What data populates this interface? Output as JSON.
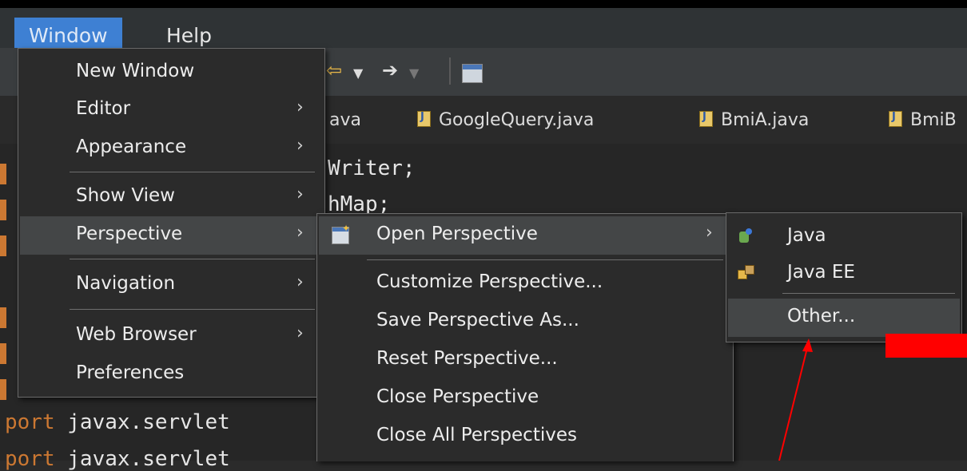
{
  "menubar": {
    "window": "Window",
    "help": "Help"
  },
  "tabs": [
    "ava",
    "GoogleQuery.java",
    "BmiA.java",
    "BmiB"
  ],
  "code": {
    "line1": "Writer;",
    "line2": "hMap;",
    "line3_kw": "port",
    "line3_rest": " javax.servlet",
    "line4_kw": "port",
    "line4_rest": " javax.servlet"
  },
  "window_menu": {
    "items": [
      {
        "label": "New Window"
      },
      {
        "label": "Editor",
        "submenu": true
      },
      {
        "label": "Appearance",
        "submenu": true
      },
      {
        "label": "Show View",
        "submenu": true
      },
      {
        "label": "Perspective",
        "submenu": true,
        "highlighted": true
      },
      {
        "label": "Navigation",
        "submenu": true
      },
      {
        "label": "Web Browser",
        "submenu": true
      },
      {
        "label": "Preferences"
      }
    ]
  },
  "perspective_menu": {
    "items": [
      {
        "label": "Open Perspective",
        "submenu": true,
        "highlighted": true,
        "icon": "open-perspective-icon"
      },
      {
        "label": "Customize Perspective..."
      },
      {
        "label": "Save Perspective As..."
      },
      {
        "label": "Reset Perspective..."
      },
      {
        "label": "Close Perspective"
      },
      {
        "label": "Close All Perspectives"
      }
    ]
  },
  "open_perspective_menu": {
    "items": [
      {
        "label": "Java",
        "icon": "java-perspective-icon"
      },
      {
        "label": "Java EE",
        "icon": "java-ee-perspective-icon"
      },
      {
        "label": "Other...",
        "highlighted": true
      }
    ]
  },
  "colors": {
    "accent": "#3e80d3",
    "highlight": "#444647",
    "annotation": "#ff0000"
  },
  "chevron": "›"
}
